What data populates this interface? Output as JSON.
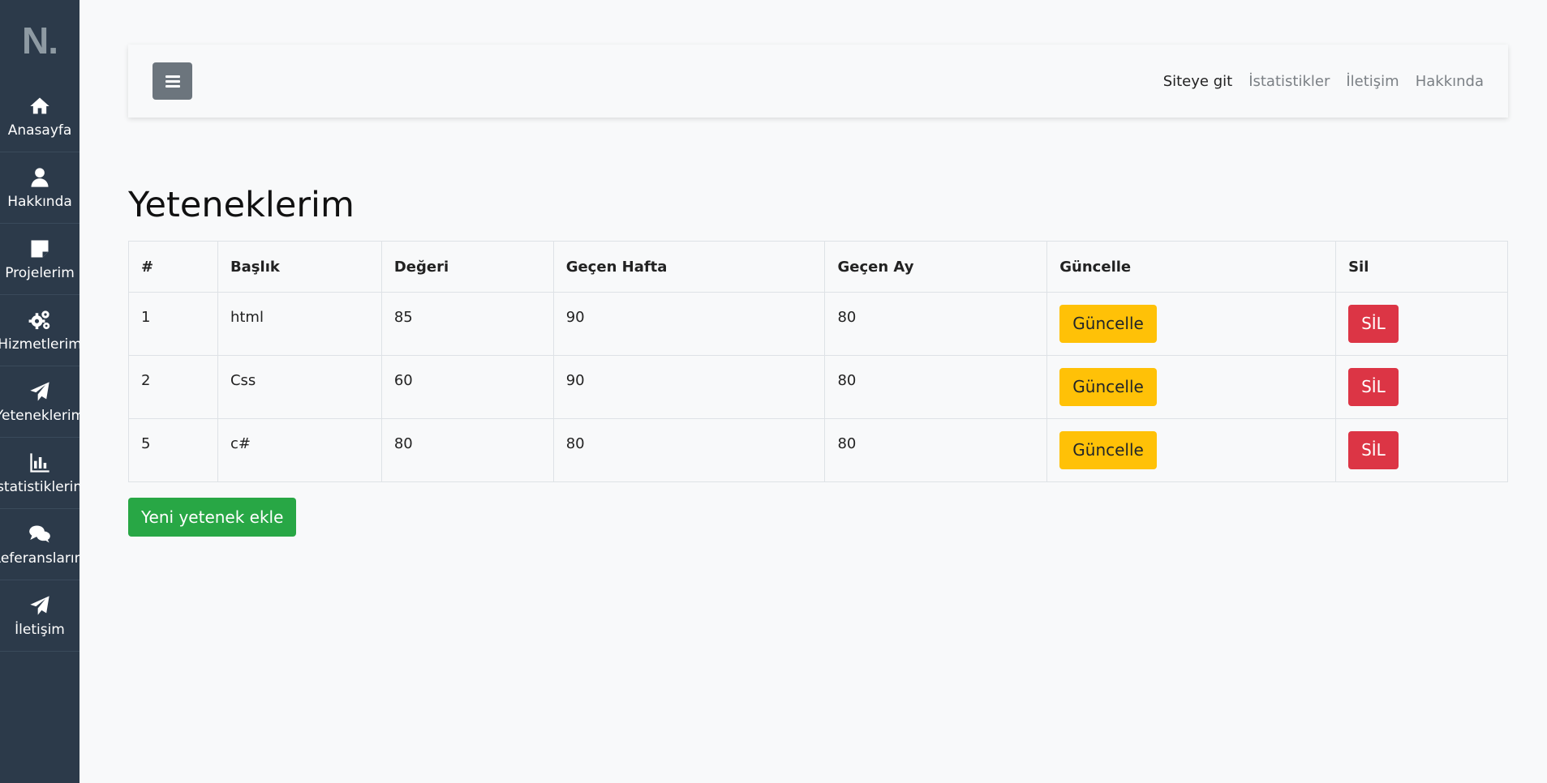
{
  "sidebar": {
    "logo": "N.",
    "items": [
      {
        "label": "Anasayfa",
        "icon": "home-icon"
      },
      {
        "label": "Hakkında",
        "icon": "user-icon"
      },
      {
        "label": "Projelerim",
        "icon": "sticky-note-icon"
      },
      {
        "label": "Hizmetlerim",
        "icon": "gears-icon"
      },
      {
        "label": "Yeteneklerim",
        "icon": "paper-plane-icon"
      },
      {
        "label": "İstatistiklerim",
        "icon": "bar-chart-icon"
      },
      {
        "label": "Referanslarım",
        "icon": "comments-icon"
      },
      {
        "label": "İletişim",
        "icon": "paper-plane-icon"
      }
    ]
  },
  "topbar": {
    "menu_icon": "hamburger-icon",
    "links": [
      "Siteye git",
      "İstatistikler",
      "İletişim",
      "Hakkında"
    ]
  },
  "page": {
    "title": "Yeteneklerim",
    "add_button": "Yeni yetenek ekle"
  },
  "table": {
    "headers": [
      "#",
      "Başlık",
      "Değeri",
      "Geçen Hafta",
      "Geçen Ay",
      "Güncelle",
      "Sil"
    ],
    "rows": [
      {
        "id": "1",
        "title": "html",
        "value": "85",
        "last_week": "90",
        "last_month": "80",
        "update": "Güncelle",
        "delete": "SİL"
      },
      {
        "id": "2",
        "title": "Css",
        "value": "60",
        "last_week": "90",
        "last_month": "80",
        "update": "Güncelle",
        "delete": "SİL"
      },
      {
        "id": "5",
        "title": "c#",
        "value": "80",
        "last_week": "80",
        "last_month": "80",
        "update": "Güncelle",
        "delete": "SİL"
      }
    ]
  },
  "colors": {
    "sidebar_bg": "#2c3a4a",
    "warning": "#ffc107",
    "danger": "#dc3545",
    "success": "#28a745",
    "menu_button": "#6c757d"
  }
}
